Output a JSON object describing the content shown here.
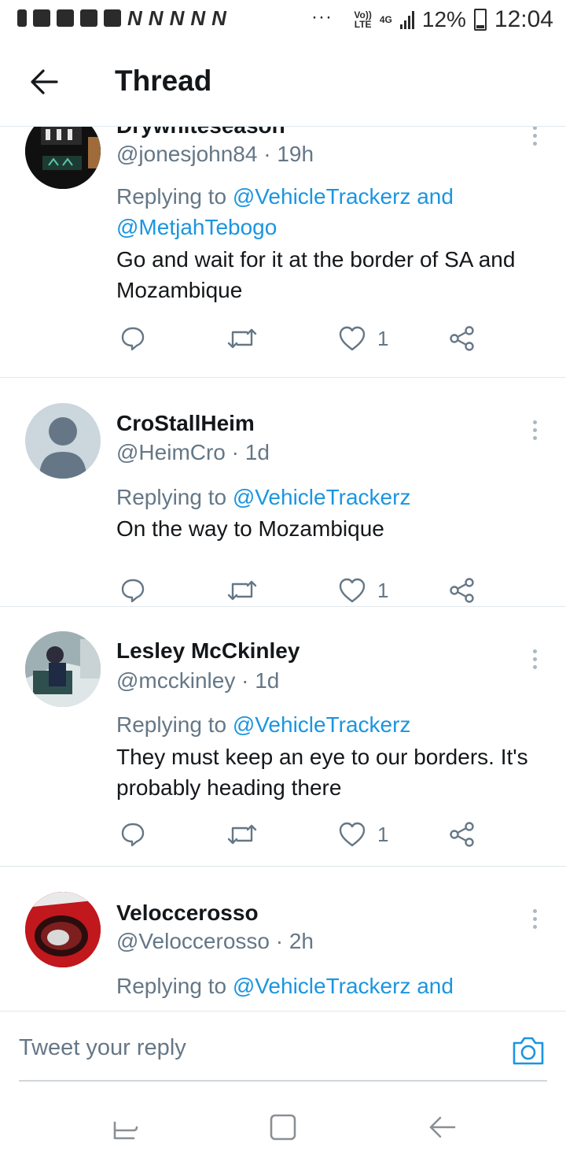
{
  "status_bar": {
    "time": "12:04",
    "battery": "12%",
    "network": "4G",
    "volte_line1": "Vo))",
    "volte_line2": "LTE",
    "dots": "···"
  },
  "header": {
    "title": "Thread"
  },
  "tweets": [
    {
      "name": "Drywhiteseason",
      "handle": "@jonesjohn84 · 19h",
      "replying_prefix": "Replying to ",
      "mentions": "@VehicleTrackerz and @MetjahTebogo",
      "text": "Go and wait for it at the border of SA and Mozambique",
      "likes": "1"
    },
    {
      "name": "CroStallHeim",
      "handle": "@HeimCro · 1d",
      "replying_prefix": "Replying to ",
      "mentions": "@VehicleTrackerz",
      "text": "On the way to Mozambique",
      "likes": "1"
    },
    {
      "name": "Lesley McCkinley",
      "handle": "@mcckinley · 1d",
      "replying_prefix": "Replying to ",
      "mentions": "@VehicleTrackerz",
      "text": "They must keep an eye to our borders. It's probably heading there",
      "likes": "1"
    },
    {
      "name": "Veloccerosso",
      "handle": "@Veloccerosso · 2h",
      "replying_prefix": "Replying to ",
      "mentions": "@VehicleTrackerz and",
      "text": "",
      "likes": ""
    }
  ],
  "composer": {
    "placeholder": "Tweet your reply"
  },
  "colors": {
    "link": "#1b95e0",
    "secondary_text": "#657786",
    "divider": "#e1e8ed"
  }
}
